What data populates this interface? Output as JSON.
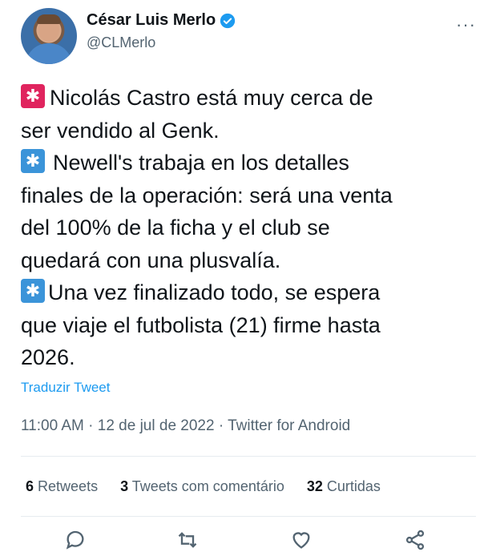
{
  "author": {
    "display_name": "César Luis Merlo",
    "handle": "@CLMerlo"
  },
  "menu_glyph": "···",
  "tweet": {
    "lines": [
      "Nicolás Castro está muy cerca de",
      "ser vendido al Genk.",
      "Newell's trabaja en los detalles",
      "finales de la operación: será una venta",
      "del 100% de la ficha y el club se",
      "quedará con una plusvalía.",
      "Una vez finalizado todo, se espera",
      "que viaje el futbolista (21) firme hasta",
      "2026."
    ],
    "translate_label": "Traduzir Tweet"
  },
  "meta": {
    "time": "11:00 AM",
    "date": "12 de jul de 2022",
    "source": "Twitter for Android",
    "separator": " · "
  },
  "stats": {
    "retweets_count": "6",
    "retweets_label": "Retweets",
    "quotes_count": "3",
    "quotes_label": "Tweets com comentário",
    "likes_count": "32",
    "likes_label": "Curtidas"
  },
  "icons": {
    "verified": "verified-badge-icon",
    "emoji_1": "rotating-light-emoji",
    "emoji_2": "eight-spoked-asterisk-emoji",
    "emoji_3": "eight-spoked-asterisk-emoji",
    "reply": "reply-icon",
    "retweet": "retweet-icon",
    "like": "heart-icon",
    "share": "share-icon"
  },
  "colors": {
    "link": "#1d9bf0",
    "verified": "#1d9bf0",
    "muted": "#536471"
  }
}
